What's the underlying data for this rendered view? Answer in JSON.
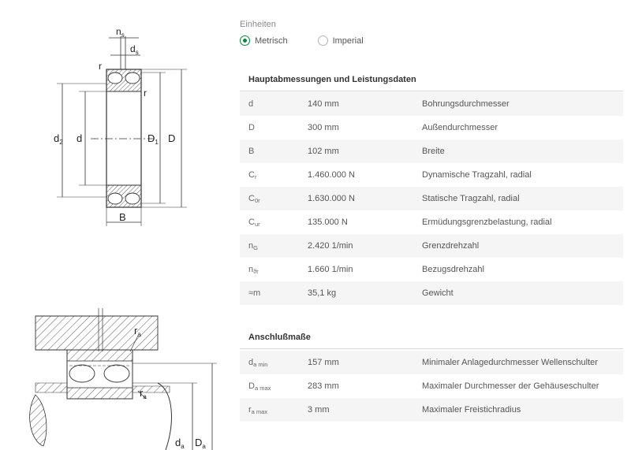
{
  "units": {
    "title": "Einheiten",
    "options": [
      {
        "label": "Metrisch",
        "selected": true
      },
      {
        "label": "Imperial",
        "selected": false
      }
    ],
    "accent_color": "#00893d"
  },
  "drawing_top": {
    "labels": {
      "ns": "n",
      "ns_sub": "s",
      "ds": "d",
      "ds_sub": "s",
      "r1": "r",
      "r2": "r",
      "d2": "d",
      "d2_sub": "2",
      "d": "d",
      "D1": "D",
      "D1_sub": "1",
      "D": "D",
      "B": "B"
    }
  },
  "drawing_bottom": {
    "labels": {
      "ra1": "r",
      "ra1_sub": "a",
      "ra2": "r",
      "ra2_sub": "a",
      "da": "d",
      "da_sub": "a",
      "Da": "D",
      "Da_sub": "a"
    }
  },
  "main_dimensions": {
    "title": "Hauptabmessungen und Leistungsdaten",
    "rows": [
      {
        "sym": "d",
        "sub": "",
        "value": "140 mm",
        "desc": "Bohrungsdurchmesser"
      },
      {
        "sym": "D",
        "sub": "",
        "value": "300 mm",
        "desc": "Außendurchmesser"
      },
      {
        "sym": "B",
        "sub": "",
        "value": "102 mm",
        "desc": "Breite"
      },
      {
        "sym": "C",
        "sub": "r",
        "value": "1.460.000 N",
        "desc": "Dynamische Tragzahl, radial"
      },
      {
        "sym": "C",
        "sub": "0r",
        "value": "1.630.000 N",
        "desc": "Statische Tragzahl, radial"
      },
      {
        "sym": "C",
        "sub": "ur",
        "value": "135.000 N",
        "desc": "Ermüdungsgrenzbelastung, radial"
      },
      {
        "sym": "n",
        "sub": "G",
        "value": "2.420 1/min",
        "desc": "Grenzdrehzahl"
      },
      {
        "sym": "n",
        "sub": "ϑr",
        "value": "1.660 1/min",
        "desc": "Bezugsdrehzahl"
      },
      {
        "sym": "≈m",
        "sub": "",
        "value": "35,1 kg",
        "desc": "Gewicht"
      }
    ]
  },
  "abutment": {
    "title": "Anschlußmaße",
    "rows": [
      {
        "sym": "d",
        "sub": "a min",
        "value": "157 mm",
        "desc": "Minimaler Anlagedurchmesser Wellenschulter"
      },
      {
        "sym": "D",
        "sub": "a max",
        "value": "283 mm",
        "desc": "Maximaler Durchmesser der Gehäuseschulter"
      },
      {
        "sym": "r",
        "sub": "a max",
        "value": "3 mm",
        "desc": "Maximaler Freistichradius"
      }
    ]
  }
}
